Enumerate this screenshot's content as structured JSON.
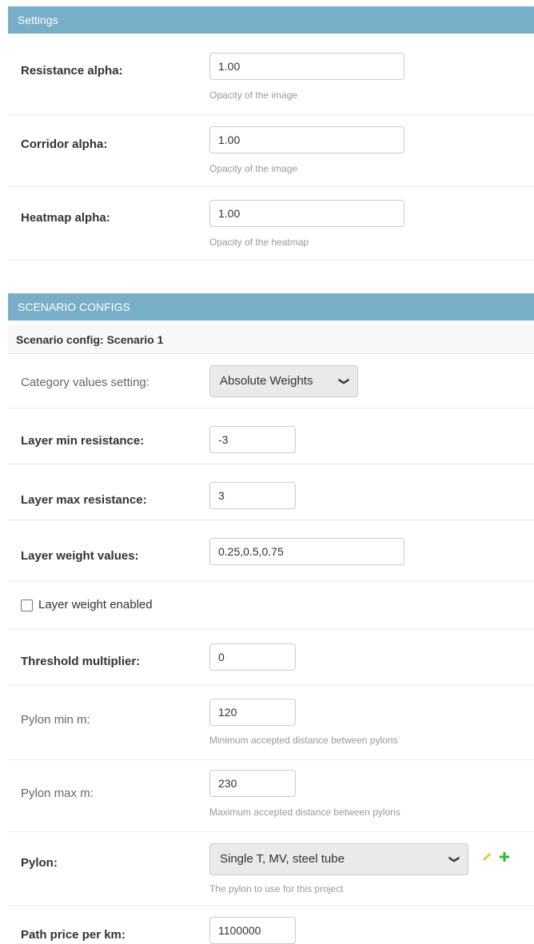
{
  "settings": {
    "header": "Settings",
    "resistance_alpha": {
      "label": "Resistance alpha:",
      "value": "1.00",
      "help": "Opacity of the image"
    },
    "corridor_alpha": {
      "label": "Corridor alpha:",
      "value": "1.00",
      "help": "Opacity of the image"
    },
    "heatmap_alpha": {
      "label": "Heatmap alpha:",
      "value": "1.00",
      "help": "Opacity of the heatmap"
    }
  },
  "scenario": {
    "header": "SCENARIO CONFIGS",
    "subheader": "Scenario config: Scenario 1",
    "category_values": {
      "label": "Category values setting:",
      "selected": "Absolute Weights"
    },
    "layer_min_resistance": {
      "label": "Layer min resistance:",
      "value": "-3"
    },
    "layer_max_resistance": {
      "label": "Layer max resistance:",
      "value": "3"
    },
    "layer_weight_values": {
      "label": "Layer weight values:",
      "value": "0.25,0.5,0.75"
    },
    "layer_weight_enabled": {
      "label": "Layer weight enabled",
      "checked": false
    },
    "threshold_multiplier": {
      "label": "Threshold multiplier:",
      "value": "0"
    },
    "pylon_min_m": {
      "label": "Pylon min m:",
      "value": "120",
      "help": "Minimum accepted distance between pylons"
    },
    "pylon_max_m": {
      "label": "Pylon max m:",
      "value": "230",
      "help": "Maximum accepted distance between pylons"
    },
    "pylon": {
      "label": "Pylon:",
      "selected": "Single T, MV, steel tube",
      "help": "The pylon to use for this project"
    },
    "path_price_per_km": {
      "label": "Path price per km:",
      "value": "1100000"
    }
  },
  "icons": {
    "chevron_down": "chevron-down-icon",
    "edit": "pencil-icon",
    "add": "plus-icon"
  },
  "colors": {
    "header_bg": "#79aec8",
    "edit_icon": "#e8c33a",
    "add_icon": "#2fbb2f"
  }
}
